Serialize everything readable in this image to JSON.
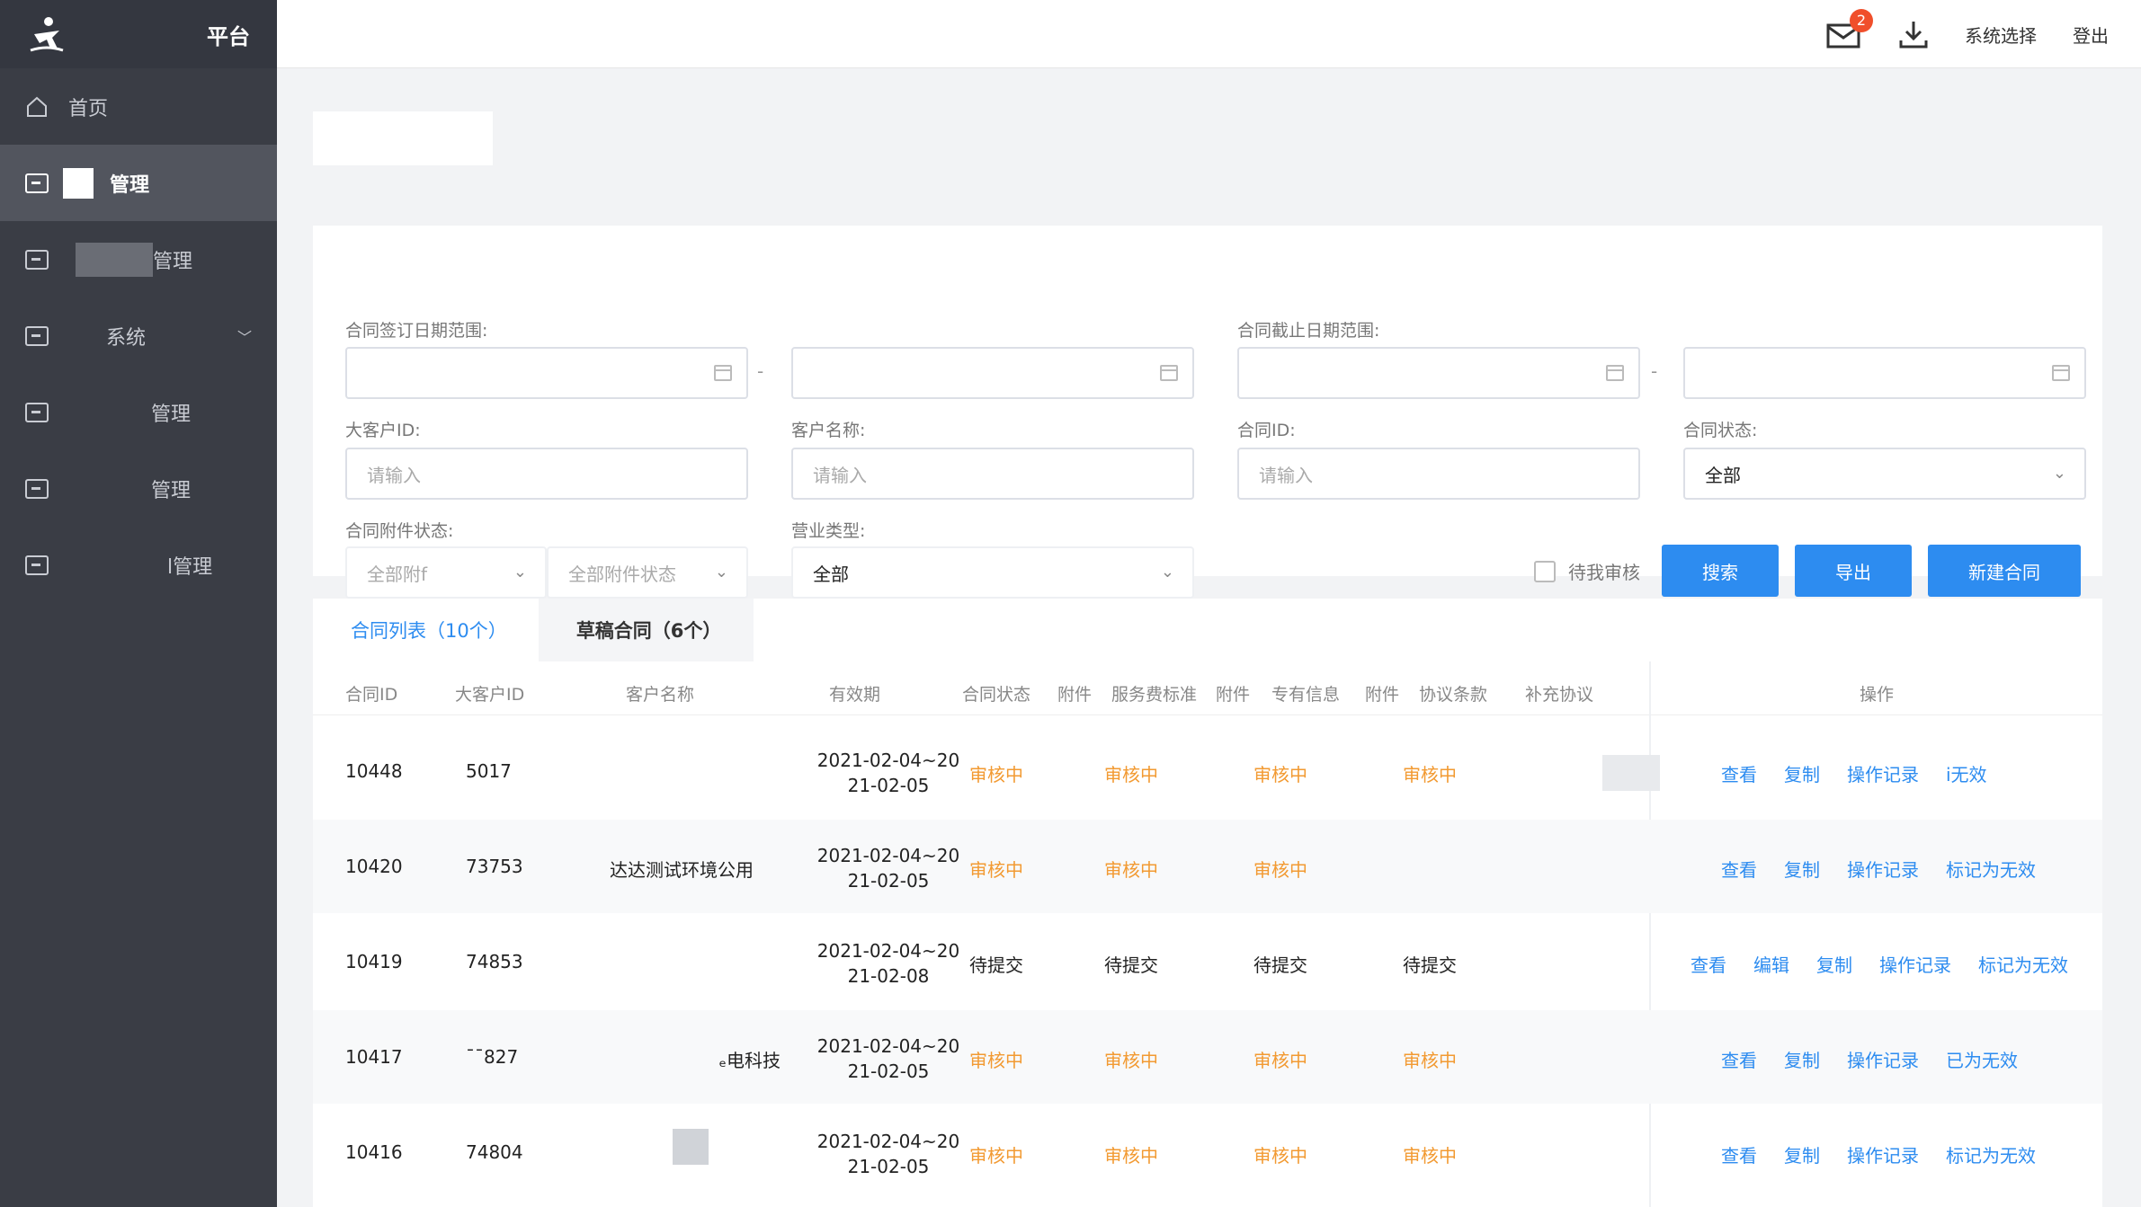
{
  "sidebar": {
    "brand_title": "平台",
    "items": [
      {
        "label": "首页"
      },
      {
        "label": "管理"
      },
      {
        "label": "管理"
      },
      {
        "label": "系统",
        "chevron": "﹀"
      },
      {
        "label": "管理"
      },
      {
        "label": "管理"
      },
      {
        "label": "l管理"
      }
    ]
  },
  "topbar": {
    "badge_count": "2",
    "system_select": "系统选择",
    "logout": "登出"
  },
  "filters": {
    "sign_date_label": "合同签订日期范围:",
    "end_date_label": "合同截止日期范围:",
    "range_dash": "-",
    "customer_id_label": "大客户ID:",
    "customer_id_placeholder": "请输入",
    "customer_name_label": "客户名称:",
    "customer_name_placeholder": "请输入",
    "contract_id_label": "合同ID:",
    "contract_id_placeholder": "请输入",
    "contract_status_label": "合同状态:",
    "contract_status_value": "全部",
    "attachment_status_label": "合同附件状态:",
    "attachment_select1": "全部附f",
    "attachment_select2": "全部附件状态",
    "business_type_label": "营业类型:",
    "business_type_value": "全部",
    "pending_review_label": "待我审核",
    "search_button": "搜索",
    "export_button": "导出",
    "new_contract_button": "新建合同"
  },
  "tabs": [
    {
      "label": "合同列表（10个）",
      "active": true
    },
    {
      "label": "草稿合同（6个）",
      "active": false
    }
  ],
  "table": {
    "headers": [
      "合同ID",
      "大客户ID",
      "客户名称",
      "有效期",
      "合同状态",
      "附件",
      "服务费标准",
      "附件",
      "专有信息",
      "附件",
      "协议条款",
      "补充协议",
      "操作"
    ],
    "rows": [
      {
        "id": "10448",
        "customer_id": "5017",
        "name": "",
        "period_line1": "2021-02-04~20",
        "period_line2": "21-02-05",
        "s1": "审核中",
        "s2": "审核中",
        "s3": "审核中",
        "s4": "审核中",
        "status_color": "#f29a32",
        "ops": [
          "查看",
          "复制",
          "操作记录",
          "i无效"
        ]
      },
      {
        "id": "10420",
        "customer_id": "73753",
        "name": "达达测试环境公用",
        "period_line1": "2021-02-04~20",
        "period_line2": "21-02-05",
        "s1": "审核中",
        "s2": "审核中",
        "s3": "审核中",
        "s4": "",
        "status_color": "#f29a32",
        "ops": [
          "查看",
          "复制",
          "操作记录",
          "标记为无效"
        ]
      },
      {
        "id": "10419",
        "customer_id": "74853",
        "name": "",
        "period_line1": "2021-02-04~20",
        "period_line2": "21-02-08",
        "s1": "待提交",
        "s2": "待提交",
        "s3": "待提交",
        "s4": "待提交",
        "status_color": "#222222",
        "ops": [
          "查看",
          "编辑",
          "复制",
          "操作记录",
          "标记为无效"
        ]
      },
      {
        "id": "10417",
        "customer_id": "¯¯827",
        "name": "ₑ电科技",
        "period_line1": "2021-02-04~20",
        "period_line2": "21-02-05",
        "s1": "审核中",
        "s2": "审核中",
        "s3": "审核中",
        "s4": "审核中",
        "status_color": "#f29a32",
        "ops": [
          "查看",
          "复制",
          "操作记录",
          "已为无效"
        ]
      },
      {
        "id": "10416",
        "customer_id": "74804",
        "name": "",
        "period_line1": "2021-02-04~20",
        "period_line2": "21-02-05",
        "s1": "审核中",
        "s2": "审核中",
        "s3": "审核中",
        "s4": "审核中",
        "status_color": "#f29a32",
        "ops": [
          "查看",
          "复制",
          "操作记录",
          "标记为无效"
        ]
      }
    ]
  }
}
